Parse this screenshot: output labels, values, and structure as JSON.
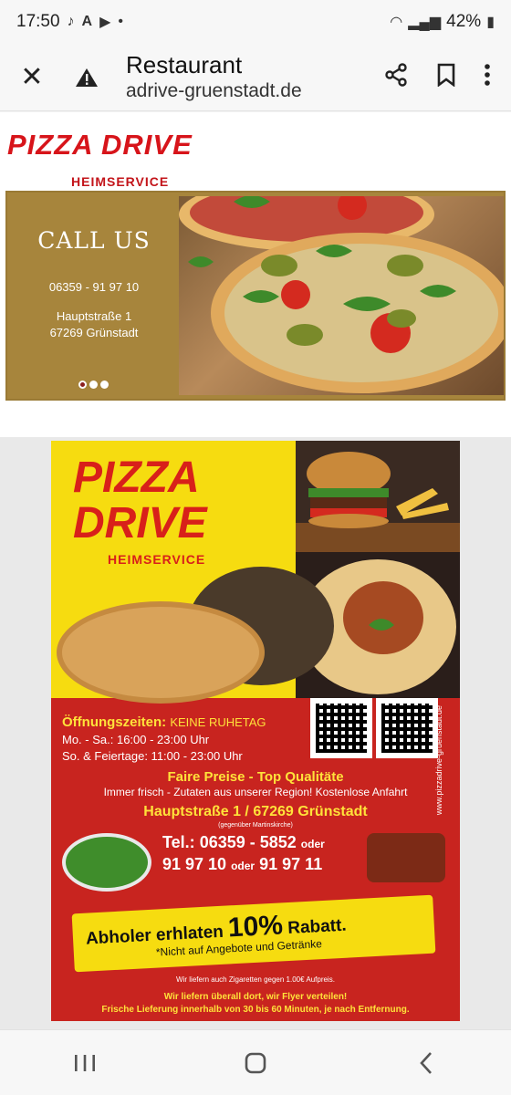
{
  "status": {
    "time": "17:50",
    "battery": "42%"
  },
  "appbar": {
    "title": "Restaurant",
    "url": "adrive-gruenstadt.de"
  },
  "logo": {
    "main": "PIZZA DRIVE",
    "sub": "HEIMSERVICE"
  },
  "banner": {
    "call_label": "CALL US",
    "phone": "06359 - 91 97 10",
    "address_line1": "Hauptstraße 1",
    "address_line2": "67269 Grünstadt"
  },
  "flyer": {
    "title": "PIZZA\nDRIVE",
    "title_line1": "PIZZA",
    "title_line2": "DRIVE",
    "subtitle": "HEIMSERVICE",
    "hours_label": "Öffnungszeiten:",
    "hours_note": "KEINE RUHETAG",
    "hours_weekday": "Mo. - Sa.: 16:00 - 23:00 Uhr",
    "hours_weekend": "So. & Feiertage: 11:00 - 23:00 Uhr",
    "website": "www.pizzadrive-gruenstadt.de",
    "fair": "Faire Preise - Top Qualitäte",
    "fresh": "Immer frisch - Zutaten aus unserer Region! Kostenlose Anfahrt",
    "address": "Hauptstraße 1 / 67269 Grünstadt",
    "landmark": "(gegenüber Martinskirche)",
    "tel_label": "Tel.:",
    "tel_main": "06359 - 5852",
    "tel_or1": "oder",
    "tel_alt1": "91 97 10",
    "tel_or2": "oder",
    "tel_alt2": "91 97 11",
    "promo_text_pre": "Abholer erhlaten",
    "promo_percent": "10%",
    "promo_text_post": "Rabatt.",
    "promo_note": "*Nicht auf Angebote und Getränke",
    "cigarettes": "Wir liefern auch Zigaretten gegen 1.00€ Aufpreis.",
    "delivery1": "Wir liefern überall dort, wir Flyer verteilen!",
    "delivery2": "Frische Lieferung innerhalb von 30 bis 60 Minuten, je nach Entfernung."
  }
}
